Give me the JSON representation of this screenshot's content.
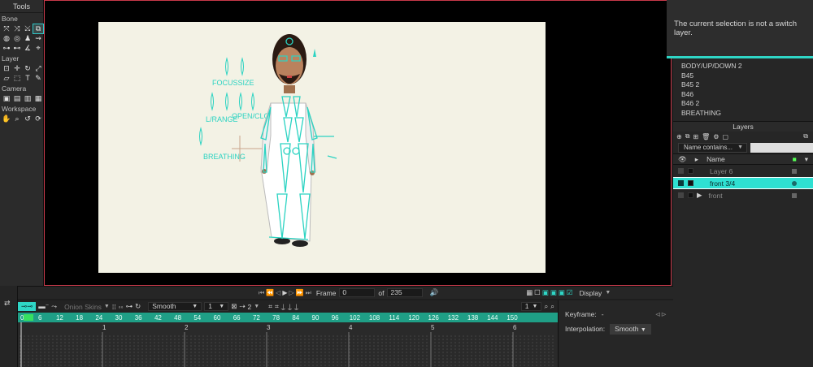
{
  "tools": {
    "title": "Tools",
    "sections": [
      {
        "label": "Bone",
        "rows": [
          [
            "bone-transform",
            "bone-add",
            "bone-select",
            "bone-reparent"
          ],
          [
            "bone-strength",
            "bone-offset",
            "bone-physics",
            "bone-manipulate"
          ],
          [
            "bone-lock",
            "bone-smart",
            "bone-angle",
            "bone-target"
          ]
        ]
      },
      {
        "label": "Layer",
        "rows": [
          [
            "layer-transform",
            "layer-translate",
            "layer-rotate",
            "layer-scale"
          ],
          [
            "layer-shear",
            "layer-select",
            "layer-text",
            "layer-eyedropper"
          ]
        ]
      },
      {
        "label": "Camera",
        "rows": [
          [
            "camera-track",
            "camera-zoom",
            "camera-roll",
            "camera-pan"
          ]
        ]
      },
      {
        "label": "Workspace",
        "rows": [
          [
            "workspace-pan",
            "workspace-zoom",
            "workspace-rotate",
            "workspace-orbit"
          ]
        ]
      }
    ]
  },
  "canvas": {
    "labels": [
      "FOCUSSIZE",
      "L/RANGE",
      "OPEN/CLOSE",
      "BREATHING"
    ]
  },
  "tooltip": {
    "text": "The current selection is not a switch layer."
  },
  "actions": {
    "items": [
      "BODY/UP/DOWN 2",
      "B45",
      "B45 2",
      "B46",
      "B46 2",
      "BREATHING"
    ]
  },
  "layers": {
    "title": "Layers",
    "filter_label": "Name contains...",
    "name_header": "Name",
    "rows": [
      {
        "name": "Layer 6",
        "active": false
      },
      {
        "name": "front 3/4",
        "active": true
      },
      {
        "name": "front",
        "active": false
      }
    ]
  },
  "playback": {
    "frame_label": "Frame",
    "frame_value": "0",
    "of_label": "of",
    "total_frames": "235",
    "display_label": "Display"
  },
  "timeline_toolbar": {
    "onion_skins": "Onion Skins",
    "interp": "Smooth",
    "step": "1",
    "range_end": "2",
    "zoom": "1"
  },
  "timeline": {
    "frame_ticks": [
      "0",
      "6",
      "12",
      "18",
      "24",
      "30",
      "36",
      "42",
      "48",
      "54",
      "60",
      "66",
      "72",
      "78",
      "84",
      "90",
      "96",
      "102",
      "108",
      "114",
      "120",
      "126",
      "132",
      "138",
      "144",
      "150"
    ],
    "second_ticks": [
      "1",
      "2",
      "3",
      "4",
      "5",
      "6"
    ]
  },
  "keyframe_panel": {
    "keyframe_label": "Keyframe:",
    "keyframe_value": "-",
    "interpolation_label": "Interpolation:",
    "interpolation_value": "Smooth"
  },
  "colors": {
    "accent": "#2fe0d2",
    "timeline_green": "#1f9f86",
    "viewport_border": "#c8394a",
    "stage_bg": "#f3f2e5"
  }
}
